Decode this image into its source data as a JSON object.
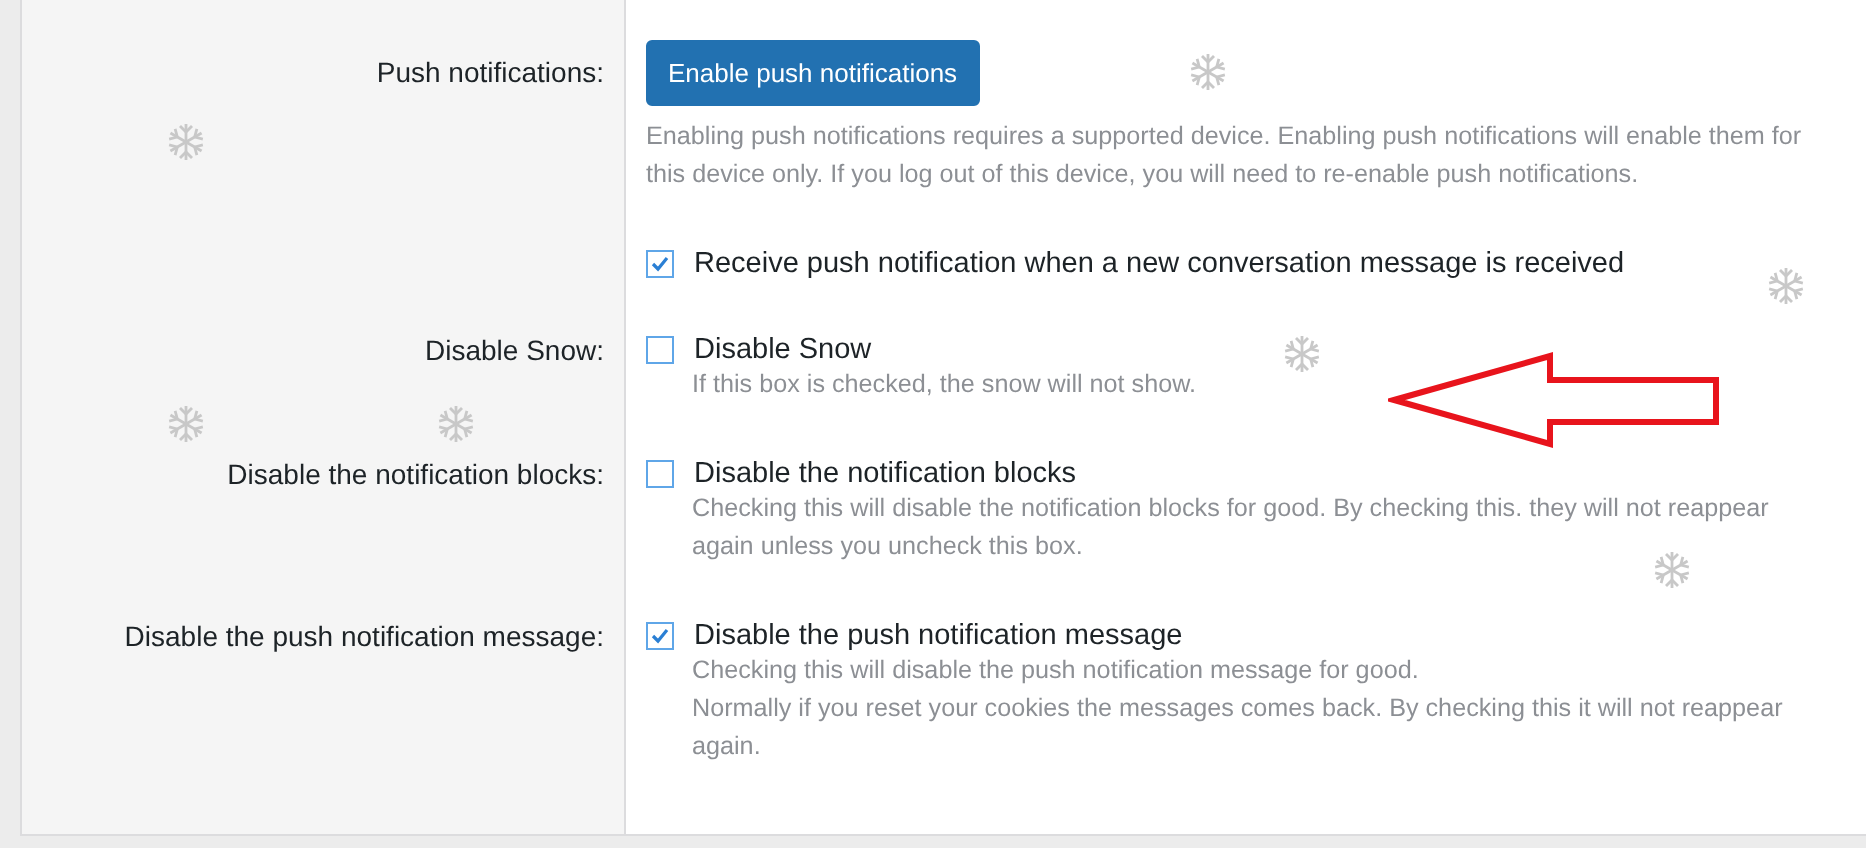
{
  "rows": [
    {
      "kind": "button",
      "label": "Push notifications:",
      "button": "Enable push notifications",
      "hint": [
        "Enabling push notifications requires a supported device. Enabling push notifications will enable them for this device only. If you log out of this device, you will need to re-enable push notifications."
      ]
    },
    {
      "kind": "checkbox",
      "checked": true,
      "text": "Receive push notification when a new conversation message is received"
    },
    {
      "kind": "checkbox",
      "label": "Disable Snow:",
      "checked": false,
      "text": "Disable Snow",
      "hint": [
        "If this box is checked, the snow will not show."
      ]
    },
    {
      "kind": "checkbox",
      "label": "Disable the notification blocks:",
      "checked": false,
      "text": "Disable the notification blocks",
      "hint": [
        "Checking this will disable the notification blocks for good. By checking this. they will not reappear again unless you uncheck this box."
      ]
    },
    {
      "kind": "checkbox",
      "label": "Disable the push notification message:",
      "checked": true,
      "text": "Disable the push notification message",
      "hint": [
        "Checking this will disable the push notification message for good.",
        "Normally if you reset your cookies the messages comes back. By checking this it will not reappear again."
      ]
    }
  ]
}
